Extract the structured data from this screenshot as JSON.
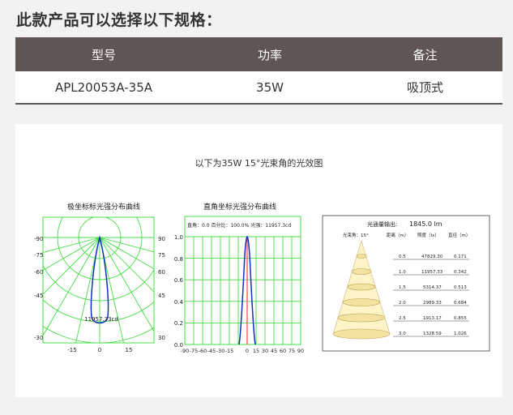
{
  "page": {
    "title": "此款产品可以选择以下规格："
  },
  "spec_table": {
    "headers": [
      "型号",
      "功率",
      "备注"
    ],
    "rows": [
      [
        "APL20053A-35A",
        "35W",
        "吸顶式"
      ]
    ]
  },
  "light_chart": {
    "title": "以下为35W 15°光束角的光效图",
    "polar": {
      "title": "极坐标标光强分布曲线",
      "left_ticks": [
        "-90",
        "-75",
        "-60",
        "-45",
        "-30"
      ],
      "right_ticks": [
        "90",
        "75",
        "60",
        "45",
        "30"
      ],
      "bottom_ticks": [
        "-15",
        "0",
        "15"
      ],
      "peak_label": "11957.33cd"
    },
    "cartesian": {
      "title": "直角坐标光强分布曲线",
      "info": "直角：0.0 百分比：100.0% 光强：11957.3cd",
      "y_ticks": [
        "0.0",
        "0.2",
        "0.4",
        "0.6",
        "0.8",
        "1.0"
      ],
      "x_ticks": [
        "-90",
        "-75",
        "-60",
        "-45",
        "-30",
        "-15",
        "0",
        "15",
        "30",
        "45",
        "60",
        "75",
        "90"
      ]
    },
    "cone": {
      "flux_label": "光通量输出:",
      "flux_value": "1845.0 lm",
      "headers": [
        "光束角：15°",
        "距离（m）",
        "照度（lx）",
        "直径（m）"
      ],
      "rows": [
        [
          "0.5",
          "47829.30",
          "0.171"
        ],
        [
          "1.0",
          "11957.33",
          "0.342"
        ],
        [
          "1.5",
          "5314.37",
          "0.513"
        ],
        [
          "2.0",
          "2989.33",
          "0.684"
        ],
        [
          "2.5",
          "1913.17",
          "0.855"
        ],
        [
          "3.0",
          "1328.59",
          "1.026"
        ]
      ]
    }
  },
  "colors": {
    "header_bg": "#5f5654",
    "grid": "#44dd44",
    "curve": "#1030c0",
    "axis_marker": "#ff4040",
    "cone_fill": "#fff3c8"
  }
}
